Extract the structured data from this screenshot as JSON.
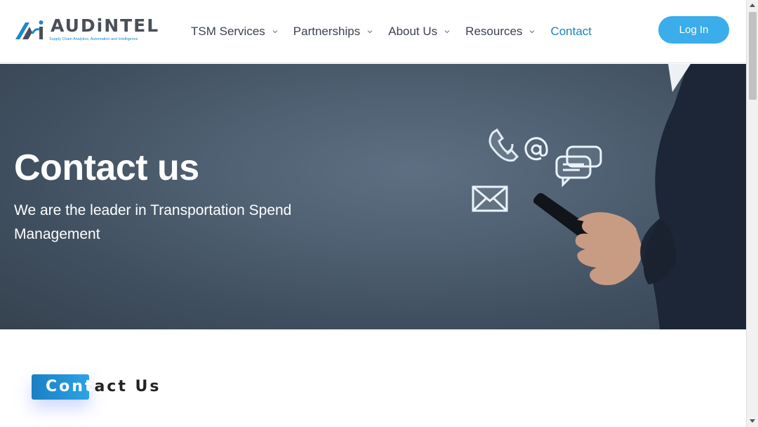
{
  "brand": {
    "name": "AUDiNTEL",
    "tagline": "Supply Chain Analytics, Automation and Intelligence",
    "mark": "Ai"
  },
  "nav": {
    "items": [
      {
        "label": "TSM Services"
      },
      {
        "label": "Partnerships"
      },
      {
        "label": "About Us"
      },
      {
        "label": "Resources"
      },
      {
        "label": "Contact"
      }
    ],
    "login_label": "Log In"
  },
  "hero": {
    "title": "Contact us",
    "subtitle": "We are the leader in Transportation Spend Management"
  },
  "section": {
    "title_highlight": "Cont",
    "title_rest": "act Us"
  },
  "colors": {
    "accent": "#3badea",
    "nav_active": "#1685c0",
    "hero_bg": "#4f6072"
  }
}
